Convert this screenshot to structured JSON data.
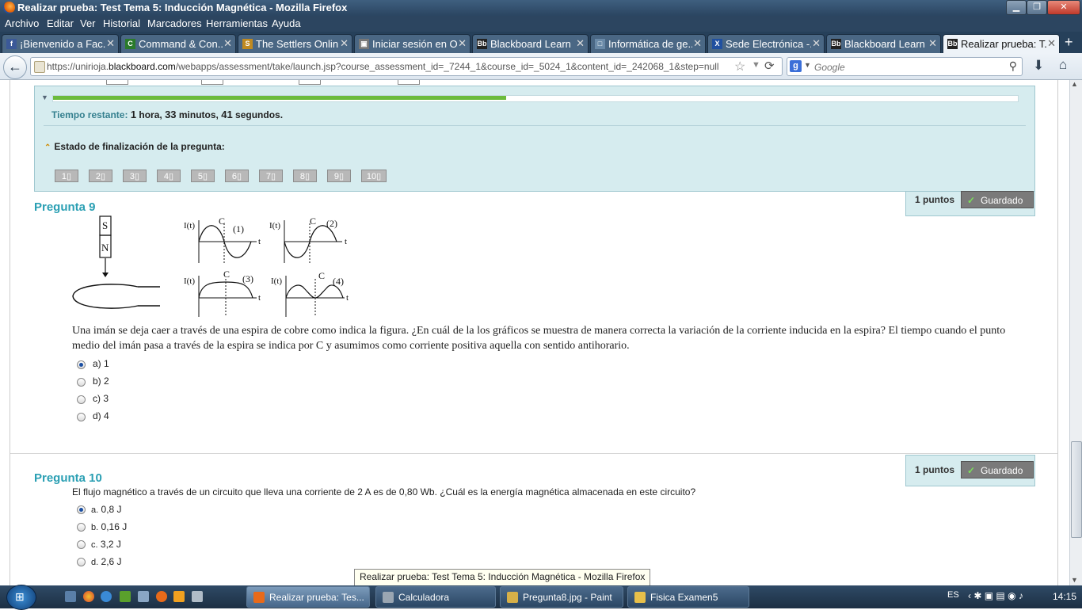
{
  "window": {
    "title": "Realizar prueba: Test Tema 5: Inducción Magnética - Mozilla Firefox",
    "minimize": "▁",
    "maximize": "❐",
    "close": "✕"
  },
  "menu": [
    "Archivo",
    "Editar",
    "Ver",
    "Historial",
    "Marcadores",
    "Herramientas",
    "Ayuda"
  ],
  "tabs": [
    {
      "icon": "f",
      "icon_color": "#3b5998",
      "label": "¡Bienvenido a Fac..."
    },
    {
      "icon": "C",
      "icon_color": "#2a7a2a",
      "label": "Command & Con..."
    },
    {
      "icon": "S",
      "icon_color": "#c08a20",
      "label": "The Settlers Onlin..."
    },
    {
      "icon": "▣",
      "icon_color": "#777777",
      "label": "Iniciar sesión en O..."
    },
    {
      "icon": "Bb",
      "icon_color": "#222222",
      "label": "Blackboard Learn"
    },
    {
      "icon": "□",
      "icon_color": "#6a8aa8",
      "label": "Informática de ge..."
    },
    {
      "icon": "X",
      "icon_color": "#2050a0",
      "label": "Sede Electrónica -..."
    },
    {
      "icon": "Bb",
      "icon_color": "#222222",
      "label": "Blackboard Learn"
    },
    {
      "icon": "Bb",
      "icon_color": "#222222",
      "label": "Realizar prueba: T..."
    }
  ],
  "new_tab": "+",
  "url": {
    "prefix": "https://unirioja.",
    "host": "blackboard.com",
    "path": "/webapps/assessment/take/launch.jsp?course_assessment_id=_7244_1&course_id=_5024_1&content_id=_242068_1&step=null"
  },
  "search": {
    "engine_glyph": "g",
    "placeholder": "Google"
  },
  "timer": {
    "progress_fraction": 0.47,
    "label": "Tiempo restante:",
    "hours": "1",
    "hours_unit": "hora,",
    "minutes": "33",
    "minutes_unit": "minutos,",
    "seconds": "41",
    "seconds_unit": "segundos."
  },
  "completion": {
    "label": "Estado de finalización de la pregunta:",
    "buttons": [
      "1",
      "2",
      "3",
      "4",
      "5",
      "6",
      "7",
      "8",
      "9",
      "10"
    ]
  },
  "q9": {
    "title": "Pregunta 9",
    "points": "1 puntos",
    "saved": "Guardado",
    "figure": {
      "magnet_top": "S",
      "magnet_bottom": "N",
      "axis_label": "I(t)",
      "time_label": "t",
      "center_label": "C",
      "graph_labels": [
        "(1)",
        "(2)",
        "(3)",
        "(4)"
      ]
    },
    "text": "Una imán se deja caer a través de una espira de cobre como indica la figura. ¿En cuál de la los gráficos se muestra de manera correcta la variación de la corriente inducida en la espira? El tiempo cuando el punto medio del imán pasa a través de la espira se indica por C y asumimos como corriente positiva aquella con sentido antihorario.",
    "options": [
      "a) 1",
      "b) 2",
      "c) 3",
      "d) 4"
    ],
    "selected": 0
  },
  "q10": {
    "title": "Pregunta 10",
    "points": "1 puntos",
    "saved": "Guardado",
    "text": "El flujo magnético a través de un circuito que lleva una corriente de 2 A es de 0,80 Wb. ¿Cuál es la energía magnética almacenada en este circuito?",
    "options": [
      {
        "letter": "a.",
        "value": "0,8 J"
      },
      {
        "letter": "b.",
        "value": "0,16 J"
      },
      {
        "letter": "c.",
        "value": "3,2 J"
      },
      {
        "letter": "d.",
        "value": "2,6 J"
      }
    ],
    "selected": 0
  },
  "tooltip": "Realizar prueba: Test Tema 5: Inducción Magnética - Mozilla Firefox",
  "taskbar": {
    "windows": [
      {
        "label": "Realizar prueba: Tes...",
        "icon_color": "#e86a1a",
        "active": true
      },
      {
        "label": "Calculadora",
        "icon_color": "#9aa6b2",
        "active": false
      },
      {
        "label": "Pregunta8.jpg - Paint",
        "icon_color": "#d7b048",
        "active": false
      },
      {
        "label": "Fisica Examen5",
        "icon_color": "#e8c04a",
        "active": false
      }
    ],
    "language": "ES",
    "clock": "14:15"
  },
  "colors": {
    "accent_title": "#2a9fb3",
    "panel_bg": "#d6ecef",
    "progress": "#6cbb3c",
    "saved_bg": "#7a7a7a"
  }
}
